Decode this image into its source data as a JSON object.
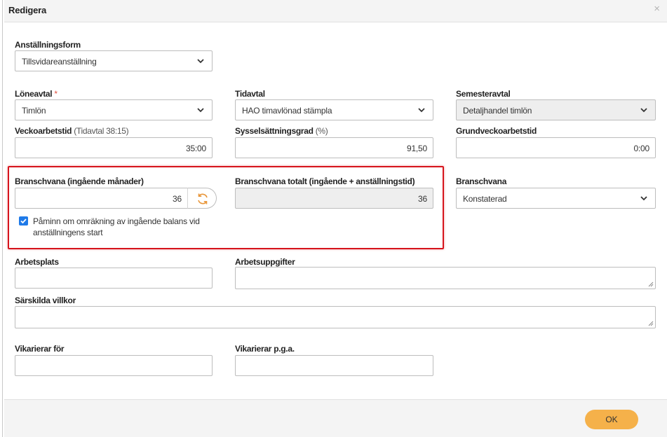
{
  "dialog": {
    "title": "Redigera",
    "close_icon": "×"
  },
  "form": {
    "anstallningsform": {
      "label": "Anställningsform",
      "value": "Tillsvidareanställning"
    },
    "loneavtal": {
      "label": "Löneavtal",
      "required_mark": "*",
      "value": "Timlön"
    },
    "tidavtal": {
      "label": "Tidavtal",
      "value": "HAO timavlönad stämpla"
    },
    "semesteravtal": {
      "label": "Semesteravtal",
      "value": "Detaljhandel timlön"
    },
    "veckoarbetstid": {
      "label": "Veckoarbetstid",
      "label_note": "(Tidavtal 38:15)",
      "value": "35:00"
    },
    "sysselsattningsgrad": {
      "label": "Sysselsättningsgrad",
      "label_note": "(%)",
      "value": "91,50"
    },
    "grundveckoarbetstid": {
      "label": "Grundveckoarbetstid",
      "value": "0:00"
    },
    "branschvana_ingaende": {
      "label": "Branschvana (ingående månader)",
      "value": "36"
    },
    "branschvana_totalt": {
      "label": "Branschvana totalt (ingående + anställningstid)",
      "value": "36"
    },
    "branschvana": {
      "label": "Branschvana",
      "value": "Konstaterad"
    },
    "reminder": {
      "label": "Påminn om omräkning av ingående balans vid anställningens start",
      "checked": true
    },
    "arbetsplats": {
      "label": "Arbetsplats",
      "value": ""
    },
    "arbetsuppgifter": {
      "label": "Arbetsuppgifter",
      "value": ""
    },
    "sarskilda_villkor": {
      "label": "Särskilda villkor",
      "value": ""
    },
    "vikarierar_for": {
      "label": "Vikarierar för",
      "value": ""
    },
    "vikarierar_pga": {
      "label": "Vikarierar p.g.a.",
      "value": ""
    }
  },
  "footer": {
    "ok_label": "OK"
  },
  "colors": {
    "accent": "#f5b14a",
    "highlight": "#d6141c",
    "checkbox": "#1f7ae8",
    "refresh_icon": "#e8963a"
  }
}
